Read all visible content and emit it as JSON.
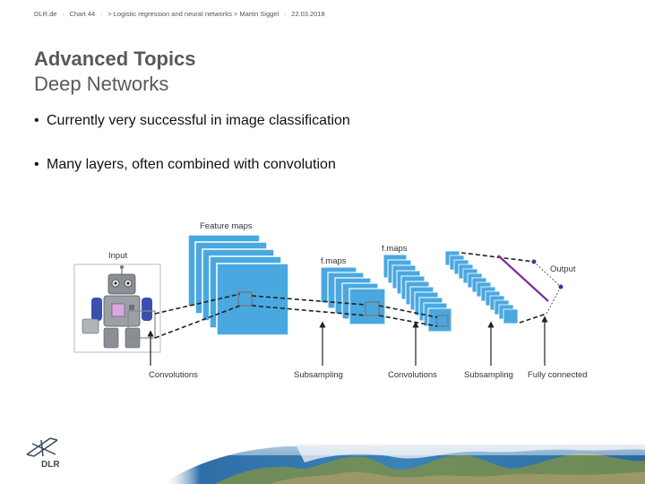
{
  "header": {
    "site": "DLR.de",
    "chart": "Chart 44",
    "info": "> Logistic regression and neural networks > Martin Siggel",
    "date": "22.03.2018"
  },
  "title": {
    "line1": "Advanced Topics",
    "line2": "Deep Networks"
  },
  "bullets": [
    "Currently very successful in image classification",
    "Many layers, often combined with convolution"
  ],
  "figure": {
    "labels": {
      "input": "Input",
      "feature_maps": "Feature maps",
      "fmaps1": "f.maps",
      "fmaps2": "f.maps",
      "output": "Output"
    },
    "bottom_labels": [
      "Convolutions",
      "Subsampling",
      "Convolutions",
      "Subsampling",
      "Fully connected"
    ],
    "colors": {
      "map_fill": "#4aa8e0",
      "map_stroke": "#ffffff",
      "output_line": "#7b2fa0"
    }
  },
  "logo": {
    "text": "DLR"
  }
}
